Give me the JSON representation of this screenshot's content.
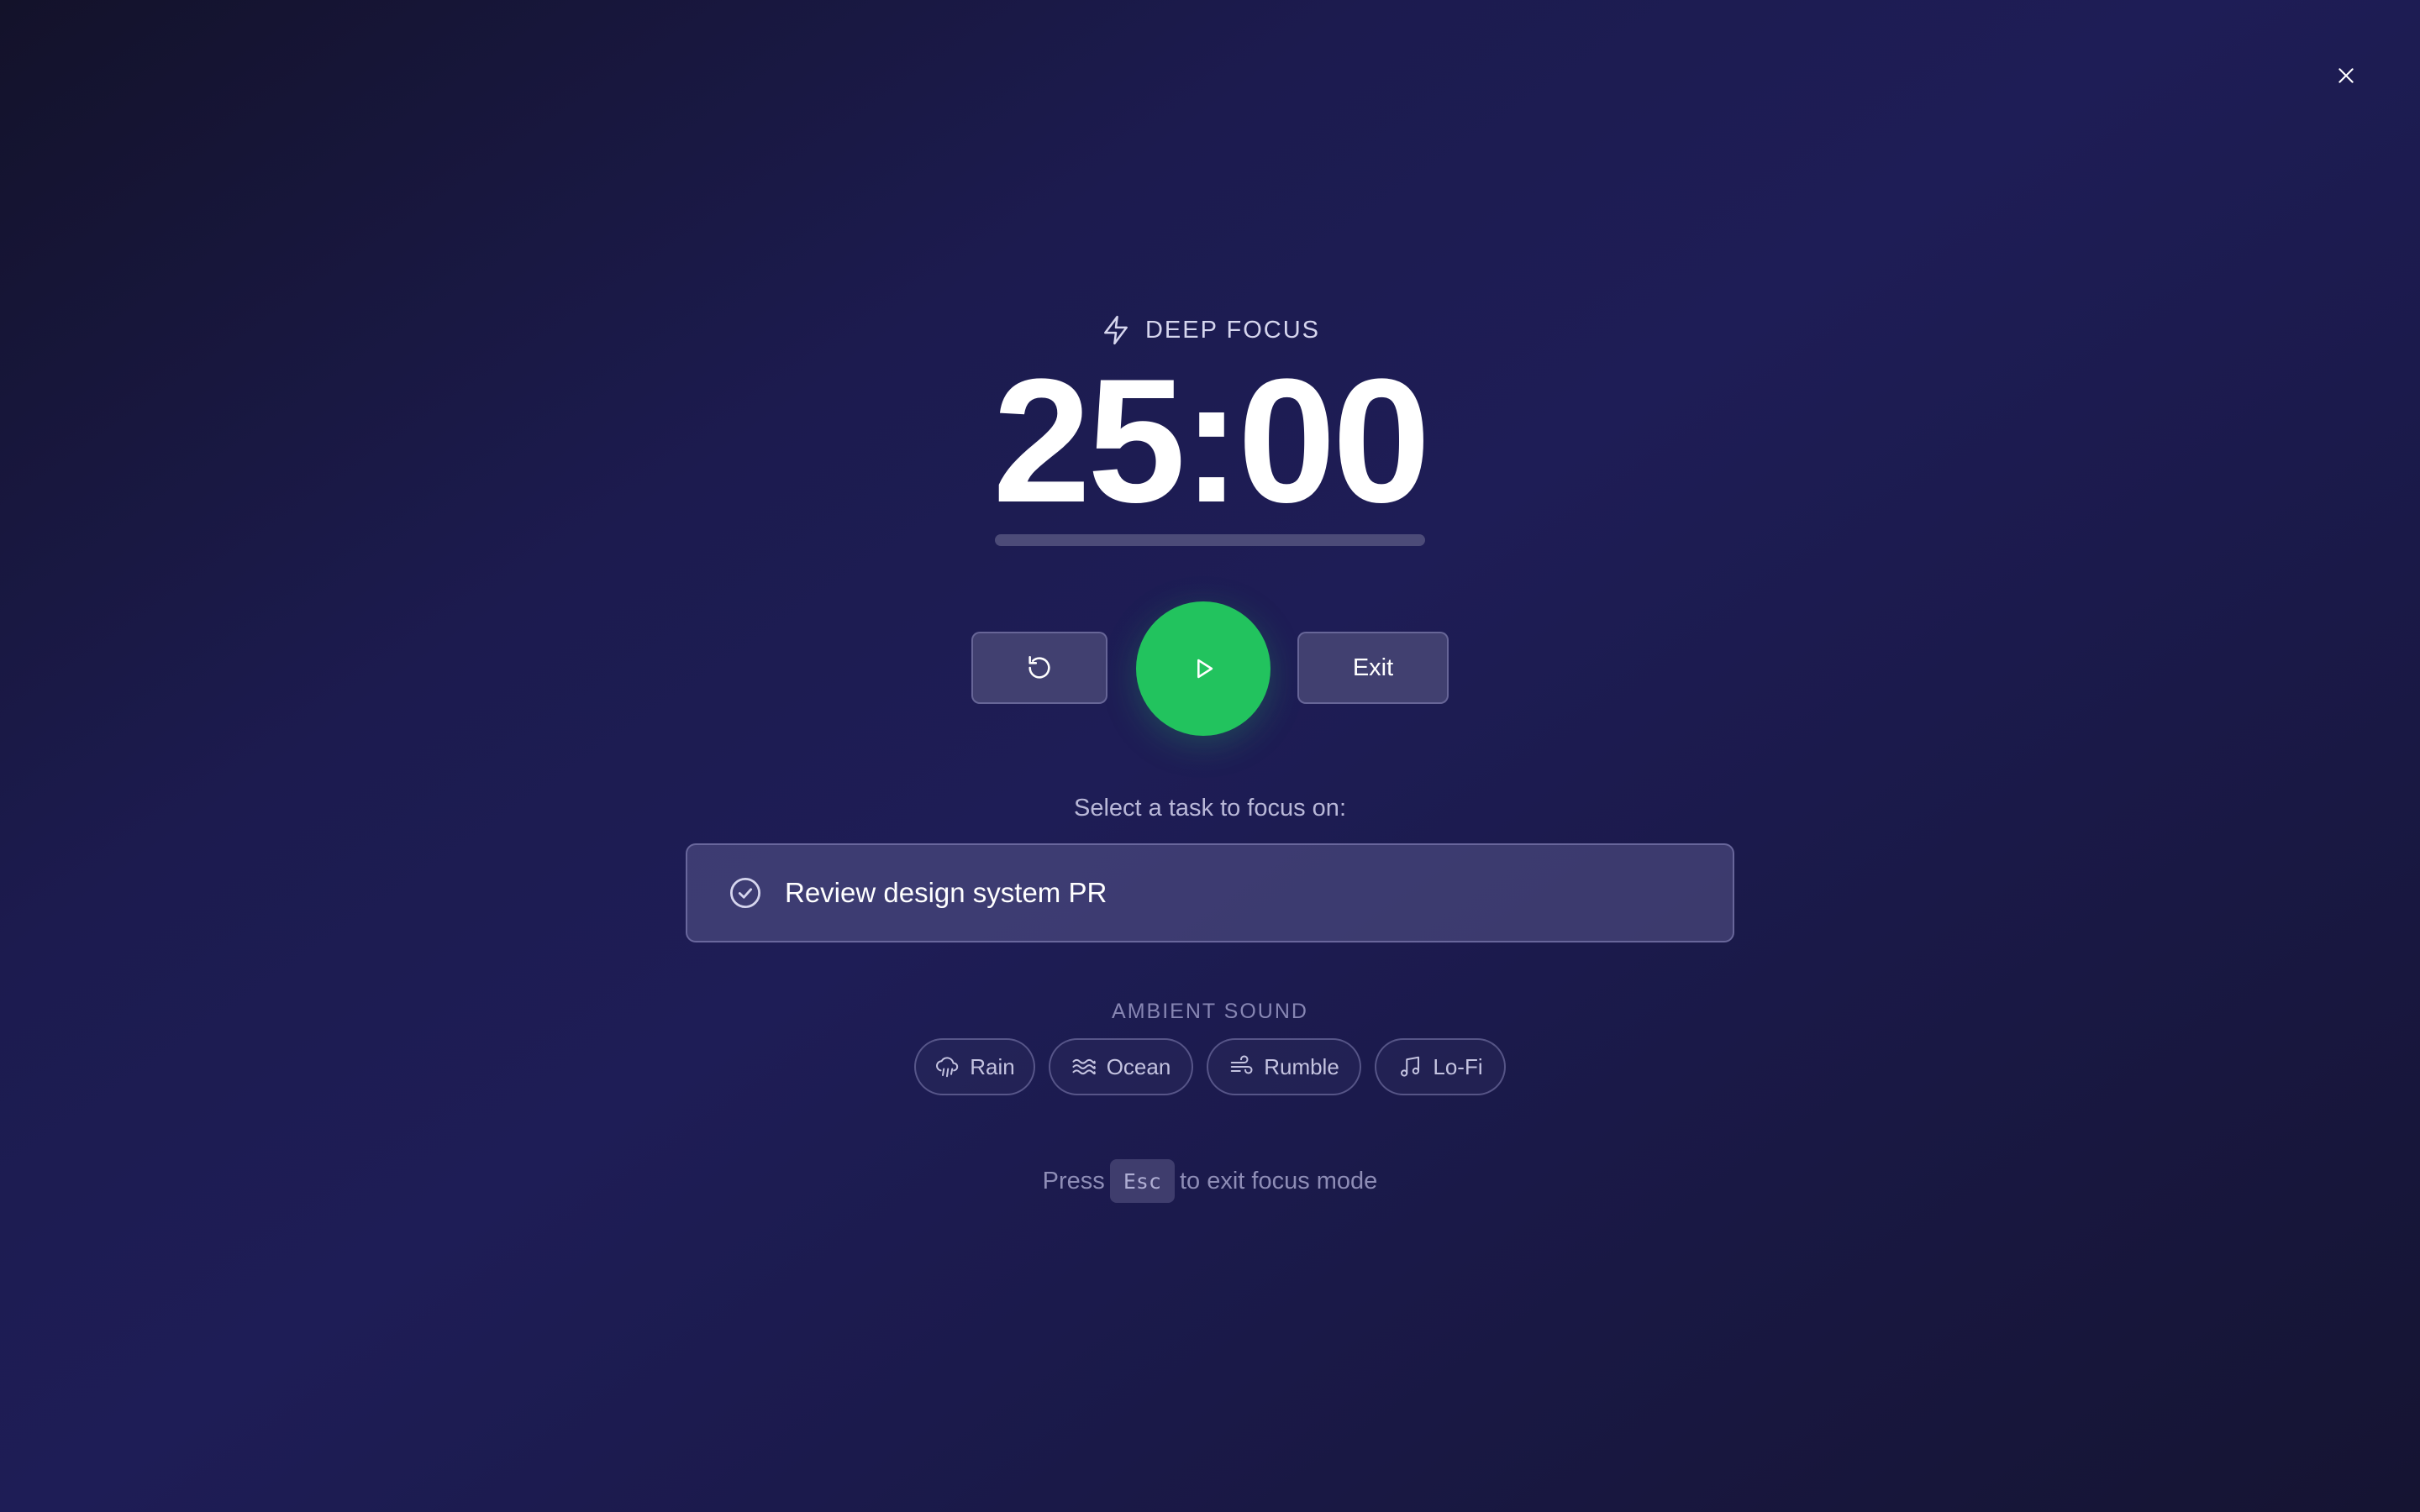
{
  "header": {
    "close_icon": "close-icon"
  },
  "session": {
    "mode_icon": "lightning-icon",
    "mode_label": "DEEP FOCUS",
    "timer": "25:00",
    "progress": 0
  },
  "controls": {
    "reset_icon": "rotate-ccw-icon",
    "play_icon": "play-icon",
    "exit_label": "Exit"
  },
  "task": {
    "prompt": "Select a task to focus on:",
    "status_icon": "check-circle-icon",
    "title": "Review design system PR"
  },
  "ambient": {
    "label": "AMBIENT SOUND",
    "sounds": [
      {
        "label": "Rain",
        "icon": "cloud-rain-icon"
      },
      {
        "label": "Ocean",
        "icon": "waves-icon"
      },
      {
        "label": "Rumble",
        "icon": "wind-icon"
      },
      {
        "label": "Lo-Fi",
        "icon": "music-icon"
      }
    ]
  },
  "hint": {
    "prefix": "Press",
    "key": "Esc",
    "suffix": "to exit focus mode"
  },
  "colors": {
    "accent_green": "#22c35e",
    "background_dark": "#13122a",
    "background_mid": "#1e1d56"
  }
}
